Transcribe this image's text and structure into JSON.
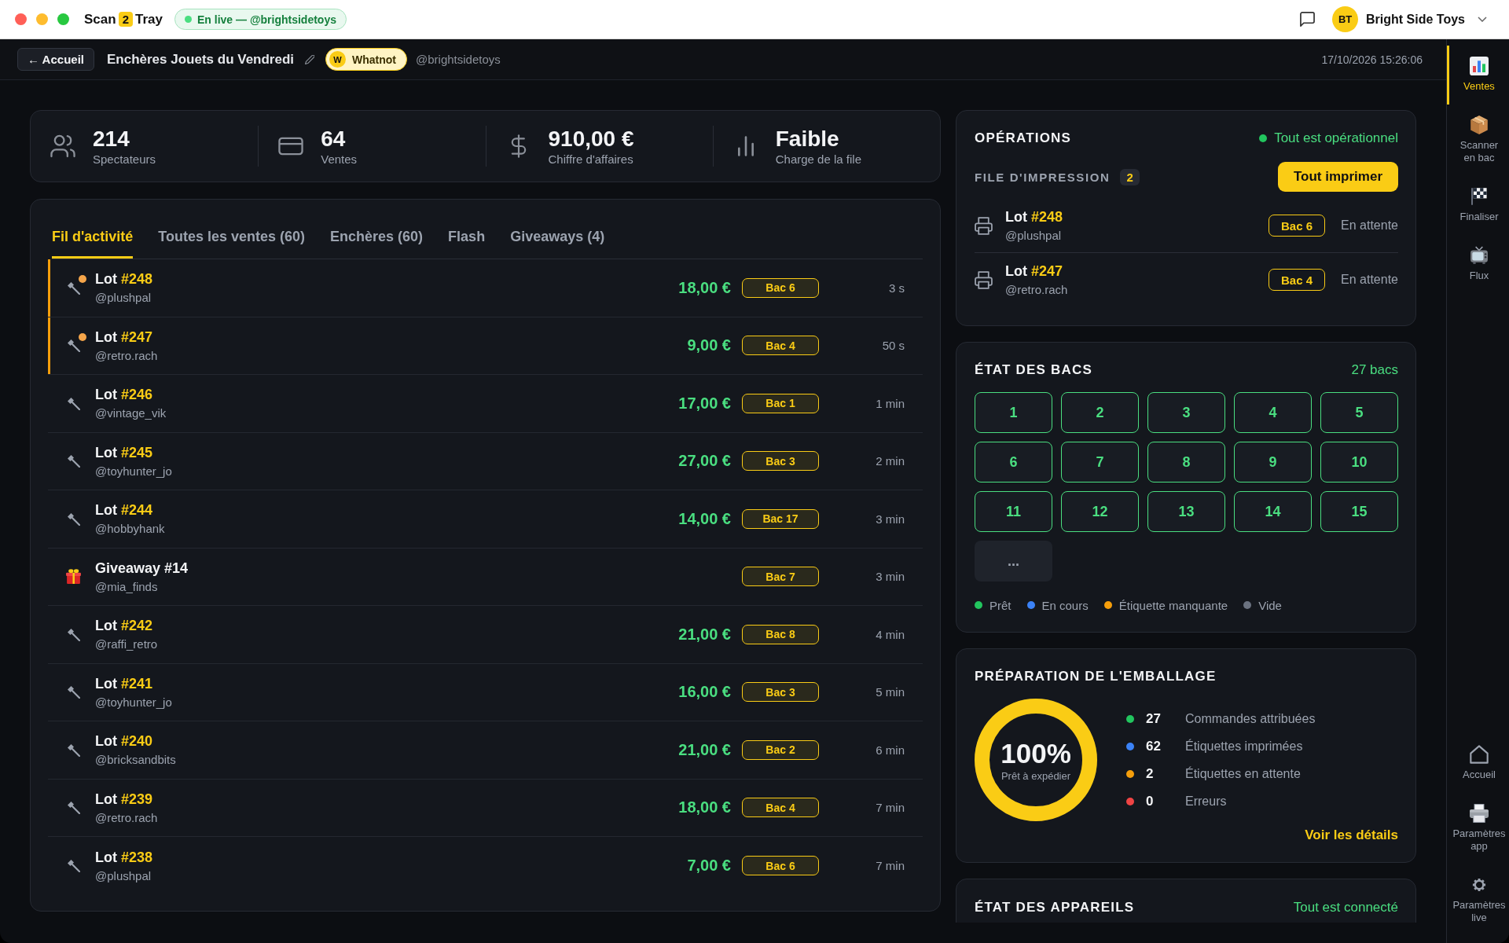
{
  "app": {
    "logo_start": "Scan",
    "logo_badge": "2",
    "logo_end": "Tray",
    "live_label": "En live — @brightsidetoys",
    "user_initials": "BT",
    "user_name": "Bright Side Toys"
  },
  "header": {
    "back_label": "← Accueil",
    "title": "Enchères Jouets du Vendredi",
    "platform_letter": "W",
    "platform_name": "Whatnot",
    "handle": "@brightsidetoys",
    "datetime": "17/10/2026 15:26:06"
  },
  "stats": [
    {
      "kind": "viewers",
      "value": "214",
      "label": "Spectateurs"
    },
    {
      "kind": "sales",
      "value": "64",
      "label": "Ventes"
    },
    {
      "kind": "revenue",
      "value": "910,00 €",
      "label": "Chiffre d'affaires"
    },
    {
      "kind": "load",
      "value": "Faible",
      "label": "Charge de la file"
    }
  ],
  "feed": {
    "tabs": [
      {
        "label": "Fil d'activité",
        "selected": true
      },
      {
        "label": "Toutes les ventes (60)",
        "selected": false
      },
      {
        "label": "Enchères (60)",
        "selected": false
      },
      {
        "label": "Flash",
        "selected": false
      },
      {
        "label": "Giveaways (4)",
        "selected": false
      }
    ],
    "rows": [
      {
        "kind": "lot",
        "title": "Lot",
        "number": "#248",
        "handle": "@plushpal",
        "price": "18,00 €",
        "bin": "Bac 6",
        "time": "3 s",
        "new": true
      },
      {
        "kind": "lot",
        "title": "Lot",
        "number": "#247",
        "handle": "@retro.rach",
        "price": "9,00 €",
        "bin": "Bac 4",
        "time": "50 s",
        "new": true
      },
      {
        "kind": "lot",
        "title": "Lot",
        "number": "#246",
        "handle": "@vintage_vik",
        "price": "17,00 €",
        "bin": "Bac 1",
        "time": "1 min",
        "new": false
      },
      {
        "kind": "lot",
        "title": "Lot",
        "number": "#245",
        "handle": "@toyhunter_jo",
        "price": "27,00 €",
        "bin": "Bac 3",
        "time": "2 min",
        "new": false
      },
      {
        "kind": "lot",
        "title": "Lot",
        "number": "#244",
        "handle": "@hobbyhank",
        "price": "14,00 €",
        "bin": "Bac 17",
        "time": "3 min",
        "new": false
      },
      {
        "kind": "giveaway",
        "title": "Giveaway",
        "number": "#14",
        "handle": "@mia_finds",
        "bin": "Bac 7",
        "time": "3 min",
        "new": false
      },
      {
        "kind": "lot",
        "title": "Lot",
        "number": "#242",
        "handle": "@raffi_retro",
        "price": "21,00 €",
        "bin": "Bac 8",
        "time": "4 min",
        "new": false
      },
      {
        "kind": "lot",
        "title": "Lot",
        "number": "#241",
        "handle": "@toyhunter_jo",
        "price": "16,00 €",
        "bin": "Bac 3",
        "time": "5 min",
        "new": false
      },
      {
        "kind": "lot",
        "title": "Lot",
        "number": "#240",
        "handle": "@bricksandbits",
        "price": "21,00 €",
        "bin": "Bac 2",
        "time": "6 min",
        "new": false
      },
      {
        "kind": "lot",
        "title": "Lot",
        "number": "#239",
        "handle": "@retro.rach",
        "price": "18,00 €",
        "bin": "Bac 4",
        "time": "7 min",
        "new": false
      },
      {
        "kind": "lot",
        "title": "Lot",
        "number": "#238",
        "handle": "@plushpal",
        "price": "7,00 €",
        "bin": "Bac 6",
        "time": "7 min",
        "new": false
      }
    ]
  },
  "operations": {
    "title": "OPÉRATIONS",
    "status": "Tout est opérationnel",
    "queue_title": "FILE D'IMPRESSION",
    "queue_count": "2",
    "print_all": "Tout imprimer",
    "queue": [
      {
        "title": "Lot",
        "number": "#248",
        "handle": "@plushpal",
        "bin": "Bac 6",
        "status": "En attente"
      },
      {
        "title": "Lot",
        "number": "#247",
        "handle": "@retro.rach",
        "bin": "Bac 4",
        "status": "En attente"
      }
    ]
  },
  "bins": {
    "title": "ÉTAT DES BACS",
    "count": "27 bacs",
    "tiles": [
      {
        "kind": "bin",
        "label": "1",
        "color": "#4ade80"
      },
      {
        "kind": "bin",
        "label": "2",
        "color": "#4ade80"
      },
      {
        "kind": "bin",
        "label": "3",
        "color": "#4ade80"
      },
      {
        "kind": "bin",
        "label": "4",
        "color": "#4ade80"
      },
      {
        "kind": "bin",
        "label": "5",
        "color": "#4ade80"
      },
      {
        "kind": "bin",
        "label": "6",
        "color": "#4ade80"
      },
      {
        "kind": "bin",
        "label": "7",
        "color": "#4ade80"
      },
      {
        "kind": "bin",
        "label": "8",
        "color": "#4ade80"
      },
      {
        "kind": "bin",
        "label": "9",
        "color": "#4ade80"
      },
      {
        "kind": "bin",
        "label": "10",
        "color": "#4ade80"
      },
      {
        "kind": "bin",
        "label": "11",
        "color": "#4ade80"
      },
      {
        "kind": "bin",
        "label": "12",
        "color": "#4ade80"
      },
      {
        "kind": "bin",
        "label": "13",
        "color": "#4ade80"
      },
      {
        "kind": "bin",
        "label": "14",
        "color": "#4ade80"
      },
      {
        "kind": "bin",
        "label": "15",
        "color": "#4ade80"
      },
      {
        "kind": "more",
        "label": "..."
      }
    ],
    "legend": [
      {
        "label": "Prêt",
        "color": "#22c55e"
      },
      {
        "label": "En cours",
        "color": "#3b82f6"
      },
      {
        "label": "Étiquette manquante",
        "color": "#f59e0b"
      },
      {
        "label": "Vide",
        "color": "#6b7280"
      }
    ]
  },
  "packing": {
    "title": "PRÉPARATION DE L'EMBALLAGE",
    "level": 1,
    "percent": "100%",
    "caption": "Prêt à expédier",
    "items": [
      {
        "value": "27",
        "label": "Commandes attribuées",
        "color": "#22c55e"
      },
      {
        "value": "62",
        "label": "Étiquettes imprimées",
        "color": "#3b82f6"
      },
      {
        "value": "2",
        "label": "Étiquettes en attente",
        "color": "#f59e0b"
      },
      {
        "value": "0",
        "label": "Erreurs",
        "color": "#ef4444"
      }
    ],
    "details_link": "Voir les détails"
  },
  "devices": {
    "title": "ÉTAT DES APPAREILS",
    "status": "Tout est connecté"
  },
  "sidebar": {
    "top": [
      {
        "kind": "sales",
        "label": "Ventes",
        "selected": true
      },
      {
        "kind": "scan",
        "label": "Scanner\nen bac",
        "selected": false
      },
      {
        "kind": "finish",
        "label": "Finaliser",
        "selected": false
      },
      {
        "kind": "stream",
        "label": "Flux",
        "selected": false
      }
    ],
    "bottom": [
      {
        "kind": "home",
        "label": "Accueil",
        "selected": false
      },
      {
        "kind": "printer",
        "label": "Paramètres\napp",
        "selected": false
      },
      {
        "kind": "gear",
        "label": "Paramètres\nlive",
        "selected": false
      }
    ]
  }
}
